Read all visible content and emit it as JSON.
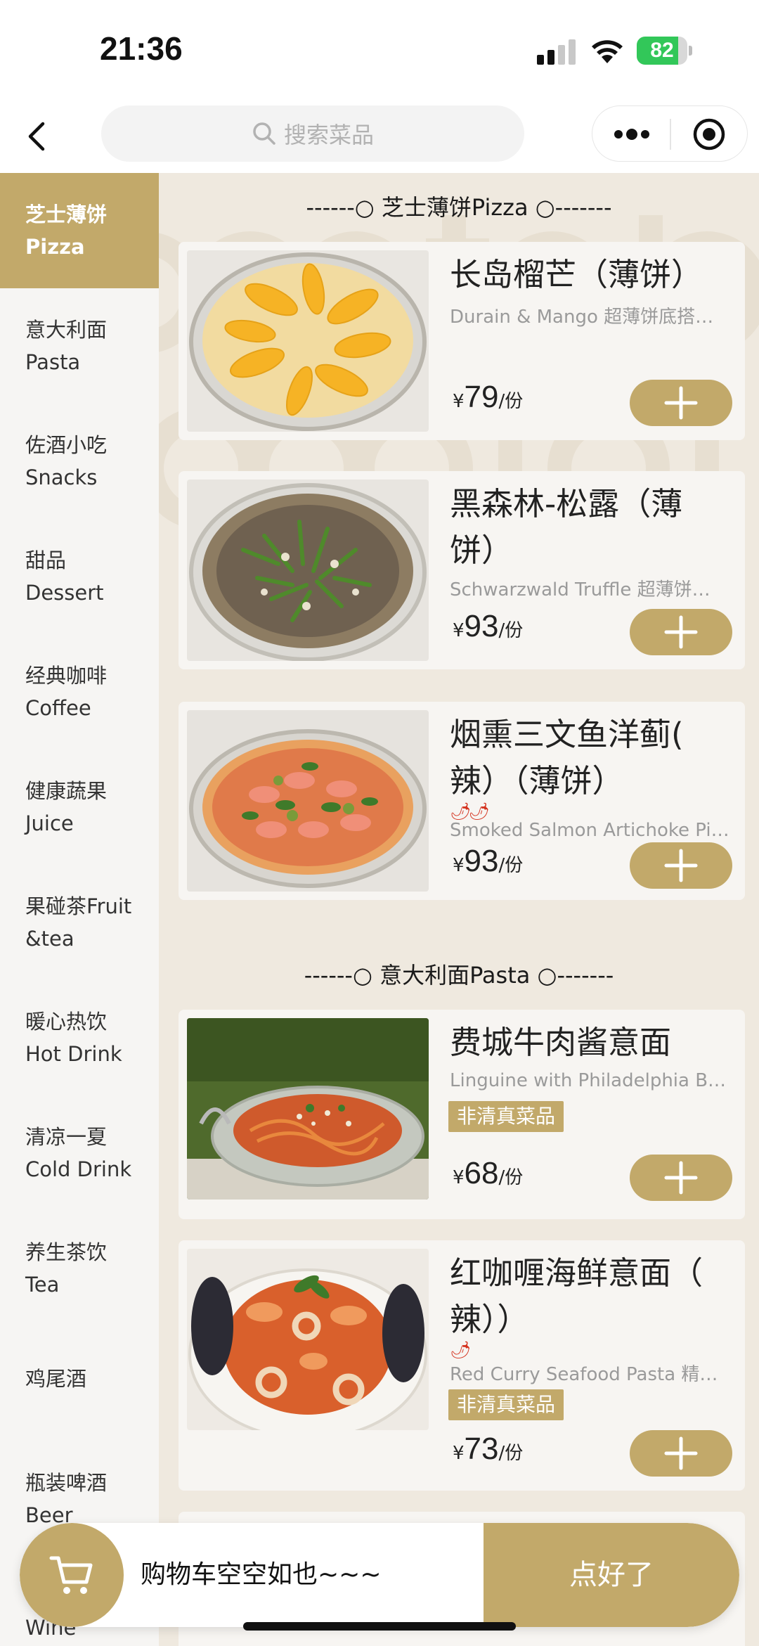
{
  "status_bar": {
    "time": "21:36",
    "battery_level": "82",
    "battery_fraction": 0.82
  },
  "nav": {
    "search_placeholder": "搜索菜品"
  },
  "colors": {
    "accent": "#c2a96a",
    "background": "#efe9df",
    "sidebar": "#f6f5f3",
    "spicy": "#d4331f"
  },
  "sidebar": {
    "items": [
      {
        "line1": "芝士薄饼",
        "line2": "Pizza",
        "active": true
      },
      {
        "line1": "意大利面",
        "line2": "Pasta"
      },
      {
        "line1": "佐酒小吃",
        "line2": "Snacks"
      },
      {
        "line1": "甜品",
        "line2": "Dessert"
      },
      {
        "line1": "经典咖啡",
        "line2": "Coffee"
      },
      {
        "line1": "健康蔬果",
        "line2": "Juice"
      },
      {
        "line1": "果碰茶Fruit",
        "line2": "&tea"
      },
      {
        "line1": "暖心热饮",
        "line2": "Hot Drink"
      },
      {
        "line1": "清凉一夏",
        "line2": "Cold Drink"
      },
      {
        "line1": "养生茶饮",
        "line2": "Tea"
      },
      {
        "line1": "鸡尾酒",
        "line2": ""
      },
      {
        "line1": "瓶装啤酒",
        "line2": "Beer"
      },
      {
        "line1": "",
        "line2": "Wine"
      }
    ]
  },
  "sections": [
    {
      "header": "------○ 芝士薄饼Pizza ○-------",
      "dishes": [
        {
          "name_line1": "长岛榴芒（薄饼）",
          "name_line2": "",
          "sub": "Durain & Mango 超薄饼底搭…",
          "currency": "¥",
          "price": "79",
          "unit": "/份",
          "image": "mango-pizza-photo"
        },
        {
          "name_line1": "黑森林-松露（薄",
          "name_line2": "饼）",
          "sub": "Schwarzwald Truffle 超薄饼…",
          "currency": "¥",
          "price": "93",
          "unit": "/份",
          "image": "truffle-pizza-photo"
        },
        {
          "name_line1": "烟熏三文鱼洋蓟(",
          "name_line2": "辣）（薄饼）",
          "spicy": "🌶🌶",
          "sub": "Smoked Salmon Artichoke Pi…",
          "currency": "¥",
          "price": "93",
          "unit": "/份",
          "image": "salmon-pizza-photo"
        }
      ]
    },
    {
      "header": "------○ 意大利面Pasta ○-------",
      "dishes": [
        {
          "name_line1": "费城牛肉酱意面",
          "name_line2": "",
          "sub": "Linguine with Philadelphia B…",
          "tag": "非清真菜品",
          "currency": "¥",
          "price": "68",
          "unit": "/份",
          "image": "beef-pasta-photo"
        },
        {
          "name_line1": "红咖喱海鲜意面（",
          "name_line2": "辣））",
          "spicy": "🌶",
          "sub": "Red Curry Seafood Pasta 精…",
          "tag": "非清真菜品",
          "currency": "¥",
          "price": "73",
          "unit": "/份",
          "image": "seafood-pasta-photo"
        }
      ]
    }
  ],
  "cart": {
    "empty_text": "购物车空空如也~~~",
    "checkout_label": "点好了"
  }
}
